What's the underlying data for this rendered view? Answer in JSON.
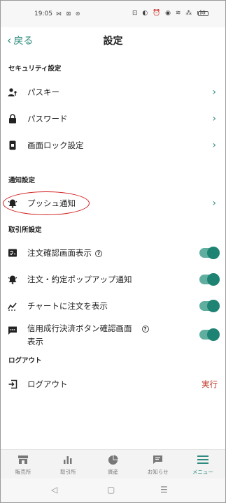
{
  "status_bar": {
    "time": "19:05",
    "left_icons": "⋈ ⊠ ⊛",
    "right_icons": "⊡ ◐ ⏰ ◉ ≋ ⁂ ıll",
    "battery": "53"
  },
  "header": {
    "back_label": "戻る",
    "back_icon": "chevron-left-icon",
    "title": "設定"
  },
  "sections": {
    "security": {
      "title": "セキュリティ設定",
      "items": [
        {
          "label": "パスキー",
          "icon": "passkey-icon"
        },
        {
          "label": "パスワード",
          "icon": "lock-icon"
        },
        {
          "label": "画面ロック設定",
          "icon": "phone-lock-icon"
        }
      ]
    },
    "notifications": {
      "title": "通知設定",
      "items": [
        {
          "label": "プッシュ通知",
          "icon": "bell-icon",
          "highlighted": true
        }
      ]
    },
    "exchange": {
      "title": "取引所設定",
      "items": [
        {
          "label": "注文確認画面表示",
          "icon": "order-confirm-icon",
          "help_icon": "help-circle-icon",
          "toggle": true
        },
        {
          "label": "注文・約定ポップアップ通知",
          "icon": "bell-icon",
          "toggle": true
        },
        {
          "label": "チャートに注文を表示",
          "icon": "chart-icon",
          "toggle": true
        },
        {
          "label_line1": "信用成行決済ボタン確認画面",
          "label_line2": "表示",
          "icon": "message-icon",
          "help_icon": "help-circle-icon",
          "toggle": true
        }
      ]
    },
    "logout": {
      "title": "ログアウト",
      "items": [
        {
          "label": "ログアウト",
          "icon": "logout-icon",
          "action": "実行"
        }
      ]
    }
  },
  "tabbar": {
    "items": [
      {
        "label": "販売所",
        "icon": "store-icon",
        "active": false
      },
      {
        "label": "取引所",
        "icon": "bar-chart-icon",
        "active": false
      },
      {
        "label": "資産",
        "icon": "pie-chart-icon",
        "active": false
      },
      {
        "label": "お知らせ",
        "icon": "message-icon",
        "active": false
      },
      {
        "label": "メニュー",
        "icon": "menu-icon",
        "active": true
      }
    ]
  },
  "colors": {
    "accent": "#2e8b7e",
    "toggle_track": "#5fae9f",
    "toggle_knob": "#1f8374",
    "danger": "#c0392b",
    "annotation": "#d01a1a"
  }
}
